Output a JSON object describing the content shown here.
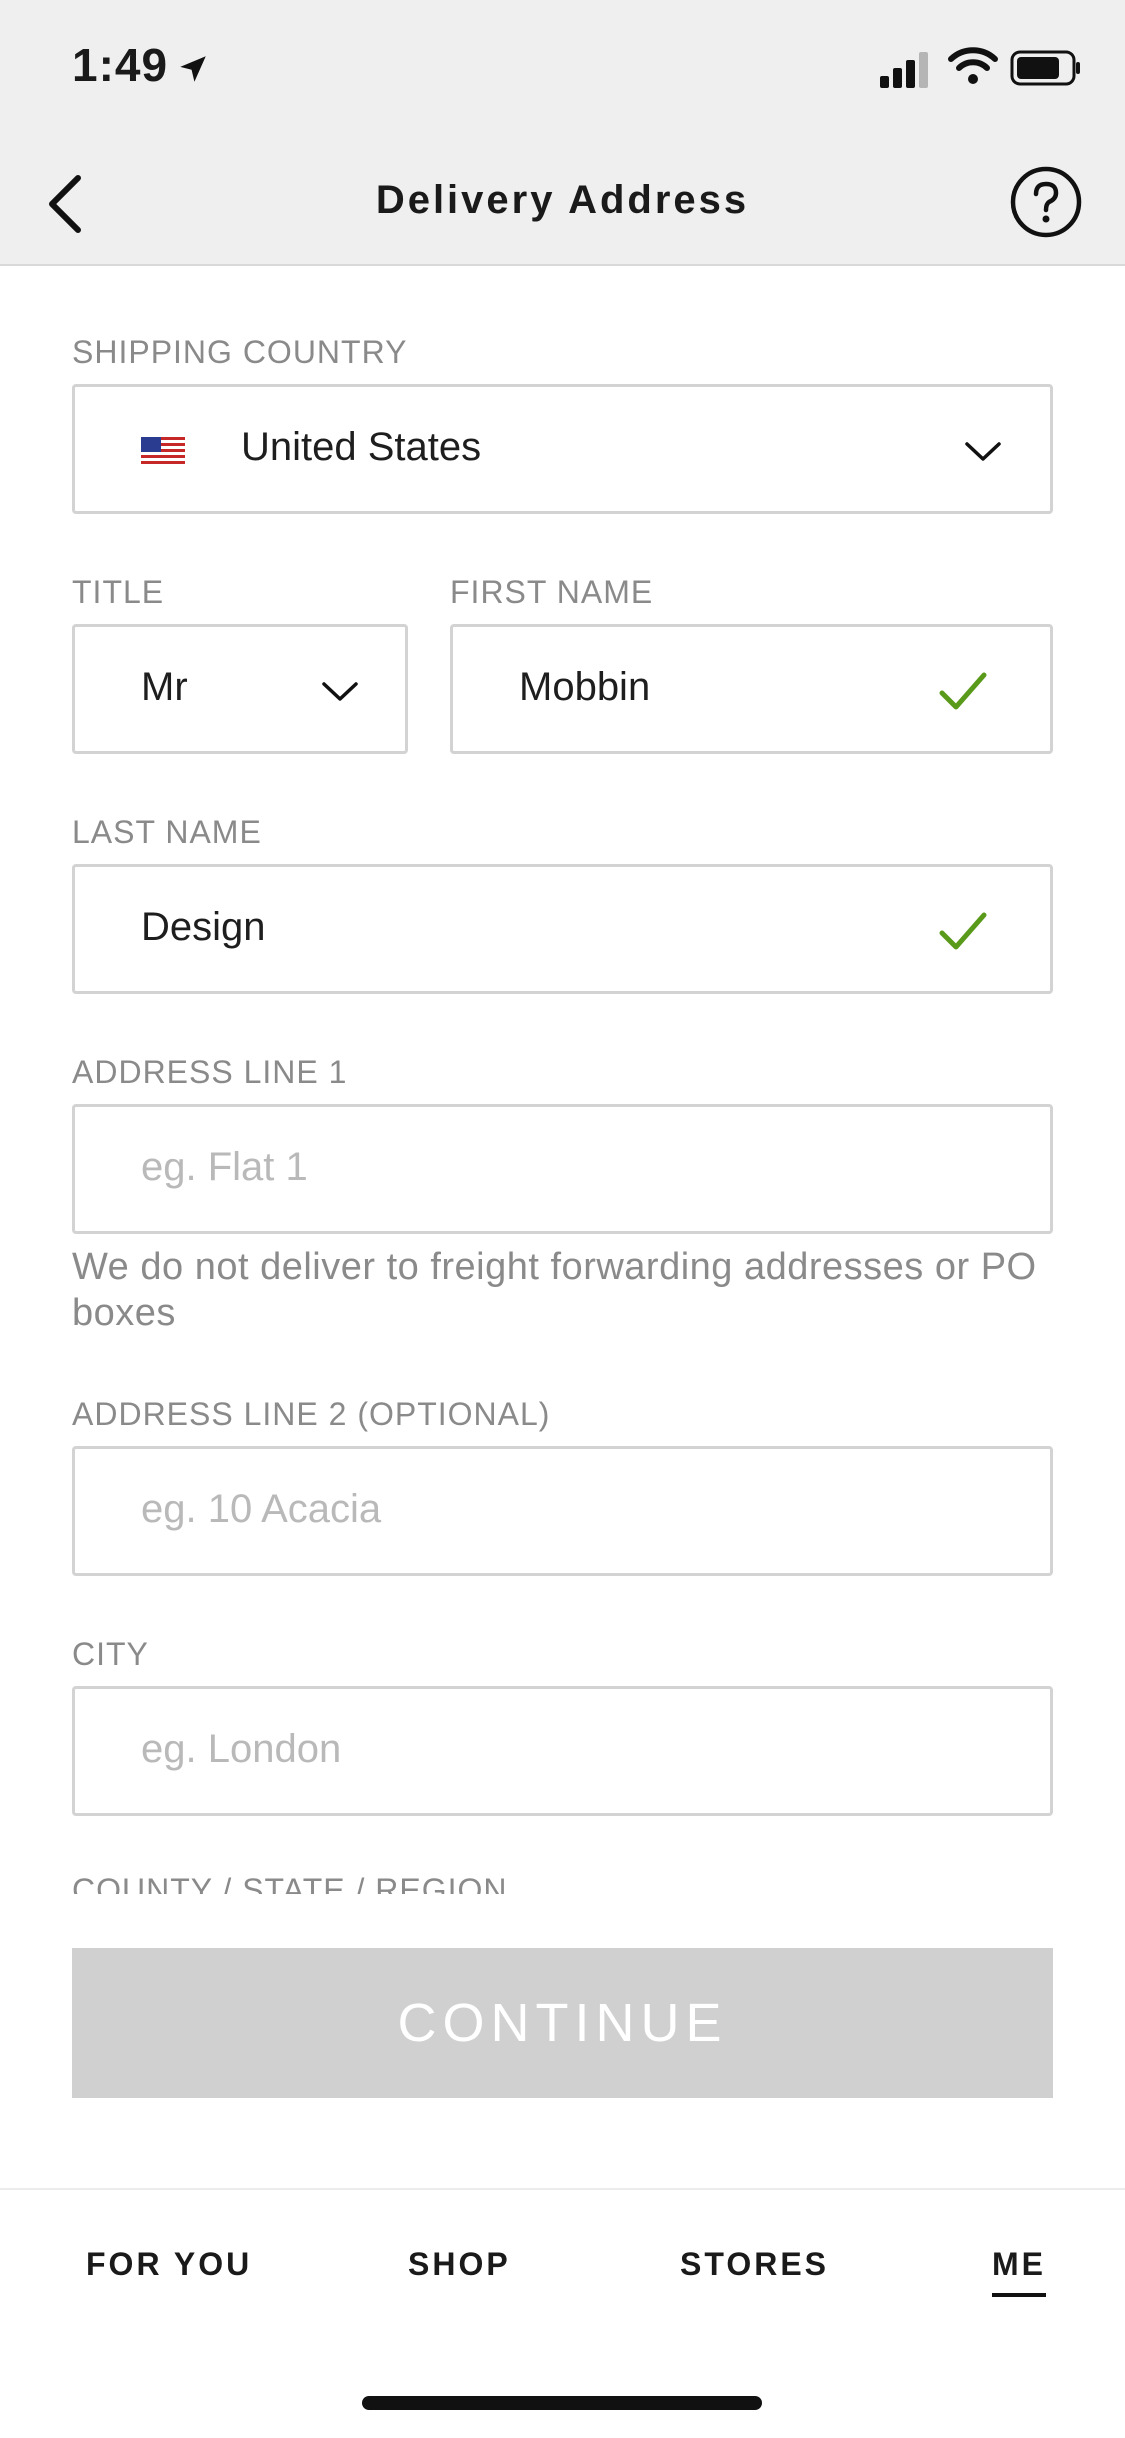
{
  "status": {
    "time": "1:49"
  },
  "nav": {
    "title": "Delivery Address"
  },
  "form": {
    "shipping_country": {
      "label": "SHIPPING COUNTRY",
      "value": "United States"
    },
    "title": {
      "label": "TITLE",
      "value": "Mr"
    },
    "first_name": {
      "label": "FIRST NAME",
      "value": "Mobbin"
    },
    "last_name": {
      "label": "LAST NAME",
      "value": "Design"
    },
    "address1": {
      "label": "ADDRESS LINE 1",
      "placeholder": "eg. Flat 1",
      "note": "We do not deliver to freight forwarding addresses or PO boxes"
    },
    "address2": {
      "label": "ADDRESS LINE 2 (OPTIONAL)",
      "placeholder": "eg. 10 Acacia"
    },
    "city": {
      "label": "CITY",
      "placeholder": "eg. London"
    },
    "county": {
      "label": "COUNTY / STATE / REGION"
    }
  },
  "continue_label": "CONTINUE",
  "tabs": [
    {
      "label": "FOR YOU"
    },
    {
      "label": "SHOP"
    },
    {
      "label": "STORES"
    },
    {
      "label": "ME"
    }
  ],
  "colors": {
    "check": "#5a9a1a",
    "button_disabled": "#d0d0d0"
  }
}
